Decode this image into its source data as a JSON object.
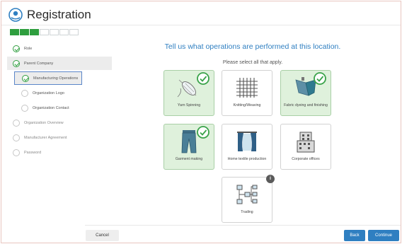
{
  "app": {
    "title": "Registration"
  },
  "progress": {
    "completed": 3,
    "total": 8
  },
  "steps": [
    {
      "label": "Role",
      "status": "complete"
    },
    {
      "label": "Parent Company",
      "status": "complete"
    },
    {
      "label": "Manufacturing Operations",
      "status": "complete"
    },
    {
      "label": "Organization Logo",
      "status": "pending"
    },
    {
      "label": "Organization Contact",
      "status": "pending"
    },
    {
      "label": "Organization Overview",
      "status": "pending"
    },
    {
      "label": "Manufacturer Agreement",
      "status": "pending"
    },
    {
      "label": "Password",
      "status": "pending"
    }
  ],
  "main": {
    "heading": "Tell us what operations are performed at this location.",
    "subheading": "Please select all that apply."
  },
  "operations": [
    {
      "label": "Yarn Spinning",
      "selected": true,
      "icon": "yarn-icon"
    },
    {
      "label": "Knitting/Weaving",
      "selected": false,
      "icon": "weave-icon"
    },
    {
      "label": "Fabric dyeing and finishing",
      "selected": true,
      "icon": "fabric-icon"
    },
    {
      "label": "Garment making",
      "selected": true,
      "icon": "jeans-icon"
    },
    {
      "label": "Home textile production",
      "selected": false,
      "icon": "curtains-icon"
    },
    {
      "label": "Corporate offices",
      "selected": false,
      "icon": "building-icon"
    },
    {
      "label": "Trading",
      "selected": false,
      "icon": "flowchart-icon",
      "info": "i"
    }
  ],
  "buttons": {
    "cancel": "Cancel",
    "back": "Back",
    "continue": "Continue"
  },
  "colors": {
    "accent": "#2f7fc1",
    "success": "#2e9e3e",
    "selected_bg": "#dff1dc"
  }
}
